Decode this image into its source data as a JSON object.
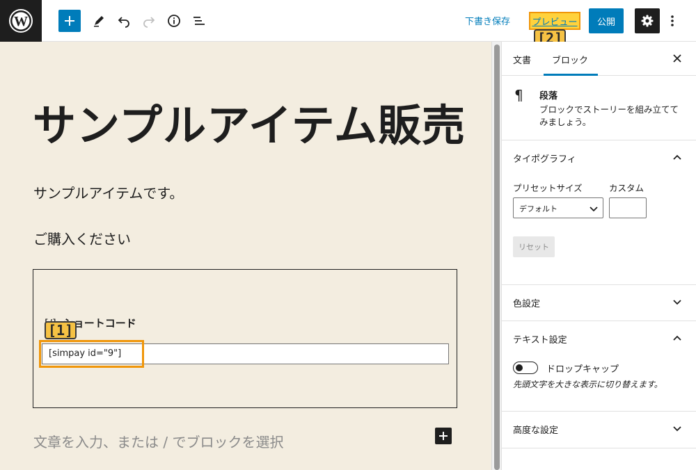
{
  "toolbar": {
    "wp_logo_icon": "wordpress-logo-icon",
    "add_block_icon": "plus-icon",
    "tools_icon": "pencil-icon",
    "undo_icon": "undo-icon",
    "redo_icon": "redo-icon",
    "info_icon": "info-icon",
    "outline_icon": "list-view-icon",
    "save_draft": "下書き保存",
    "preview": "プレビュー",
    "publish": "公開",
    "settings_icon": "gear-icon",
    "more_icon": "vertical-ellipsis-icon",
    "accent_color": "#007cba"
  },
  "annotations": {
    "badge1": "[1]",
    "badge2": "[2]",
    "highlight_color": "#f0960a"
  },
  "editor": {
    "title": "サンプルアイテム販売",
    "paragraph1": "サンプルアイテムです。",
    "paragraph2": "ご購入ください",
    "shortcode": {
      "icon_text": "[/]",
      "label": "ショートコード",
      "value": "[simpay id=\"9\"]"
    },
    "placeholder": "文章を入力、または / でブロックを選択",
    "inline_add_icon": "plus-icon",
    "background_color": "#f3ede0"
  },
  "sidebar": {
    "tab_document": "文書",
    "tab_block": "ブロック",
    "close_icon": "close-icon",
    "block": {
      "icon": "paragraph-icon",
      "name": "段落",
      "description": "ブロックでストーリーを組み立ててみましょう。"
    },
    "typography": {
      "title": "タイポグラフィ",
      "preset_label": "プリセットサイズ",
      "custom_label": "カスタム",
      "preset_value": "デフォルト",
      "custom_value": "",
      "reset": "リセット"
    },
    "color_settings": {
      "title": "色設定"
    },
    "text_settings": {
      "title": "テキスト設定",
      "dropcap_label": "ドロップキャップ",
      "dropcap_help": "先頭文字を大きな表示に切り替えます。",
      "dropcap_enabled": false
    },
    "advanced": {
      "title": "高度な設定"
    }
  }
}
